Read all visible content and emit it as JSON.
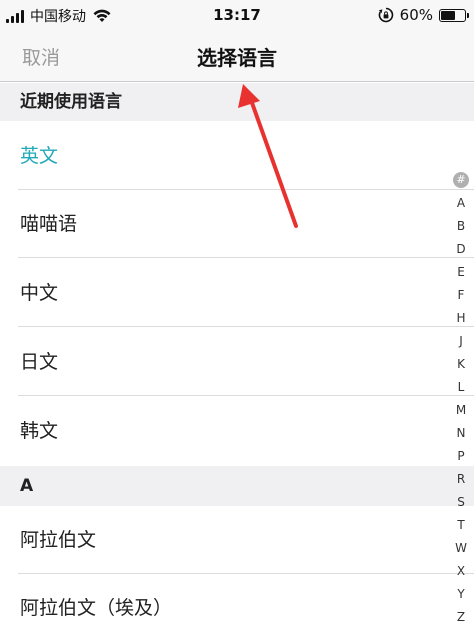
{
  "status": {
    "carrier": "中国移动",
    "time": "13:17",
    "battery": "60%",
    "battery_level": 0.6
  },
  "nav": {
    "cancel_label": "取消",
    "title": "选择语言"
  },
  "recent_section": {
    "header": "近期使用语言",
    "items": [
      {
        "label": "英文",
        "selected": true
      },
      {
        "label": "喵喵语"
      },
      {
        "label": "中文"
      },
      {
        "label": "日文"
      },
      {
        "label": "韩文"
      }
    ]
  },
  "a_section": {
    "header": "A",
    "items": [
      {
        "label": "阿拉伯文"
      },
      {
        "label": "阿拉伯文（埃及）"
      }
    ]
  },
  "index_bar": {
    "hash": "#",
    "letters": [
      "A",
      "B",
      "D",
      "E",
      "F",
      "H",
      "J",
      "K",
      "L",
      "M",
      "N",
      "P",
      "R",
      "S",
      "T",
      "W",
      "X",
      "Y",
      "Z"
    ]
  },
  "colors": {
    "selected_text": "#22a9b8",
    "annotation_arrow": "#e8322f"
  },
  "icons": {
    "signal": "signal-bars-icon",
    "wifi": "wifi-icon",
    "rotation_lock": "rotation-lock-icon",
    "battery": "battery-icon",
    "annotation": "red-arrow-annotation-icon"
  }
}
